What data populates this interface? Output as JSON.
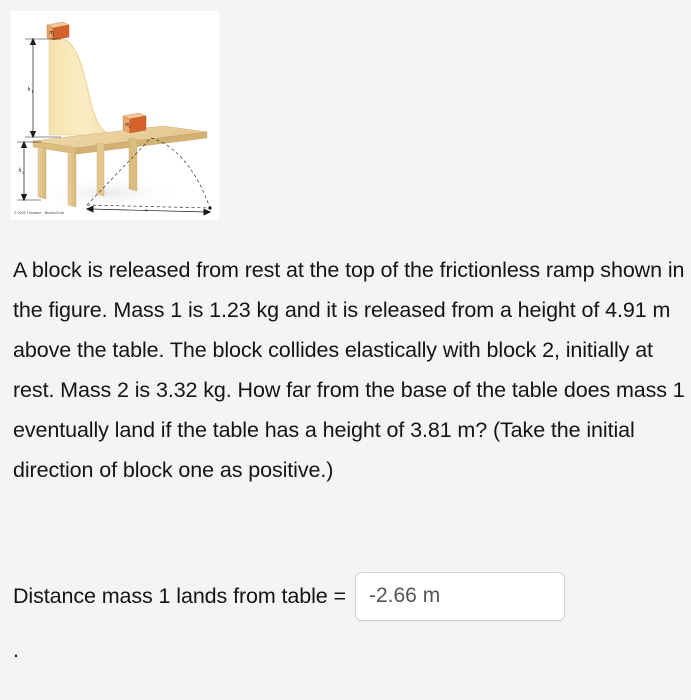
{
  "page": {
    "background_color": "#f4f4f4",
    "text_color": "#141414"
  },
  "figure": {
    "alt_name": "block-ramp-table-diagram",
    "background_color": "#ffffff",
    "copyright": "© 2003 Thomson - Brooks/Cole",
    "labels": {
      "mass1": "m",
      "mass1_sub": "1",
      "mass2": "m",
      "mass2_sub": "2",
      "height1": "h",
      "height1_sub": "1",
      "height2": "h",
      "height2_sub": "2",
      "distance": "x"
    },
    "colors": {
      "ramp": "#f7e6b0",
      "ramp_edge": "#e0c97a",
      "table_top": "#efd9a8",
      "table_side": "#dcbd7e",
      "table_leg": "#e3c68c",
      "block_front": "#e8a46a",
      "block_top": "#f0c79a",
      "block_side": "#d4622a",
      "trajectory": "#333333",
      "dimension": "#1a1a1a"
    }
  },
  "problem": {
    "text": "A block is released from rest at the top of the frictionless ramp shown in the figure. Mass 1 is 1.23 kg and it is released from a height of 4.91 m above the table. The block collides elastically with block 2, initially at rest. Mass 2 is 3.32 kg. How far from the base of the table does mass 1 eventually land if the table has a height of 3.81 m? (Take the initial direction of block one as positive.)",
    "given": {
      "mass1_kg": "1.23",
      "release_height_m": "4.91",
      "mass2_kg": "3.32",
      "table_height_m": "3.81"
    }
  },
  "answer": {
    "label": "Distance mass 1 lands from table =",
    "value": "-2.66 m",
    "placeholder": "",
    "unit": "m"
  },
  "trailing": {
    "period": "."
  }
}
